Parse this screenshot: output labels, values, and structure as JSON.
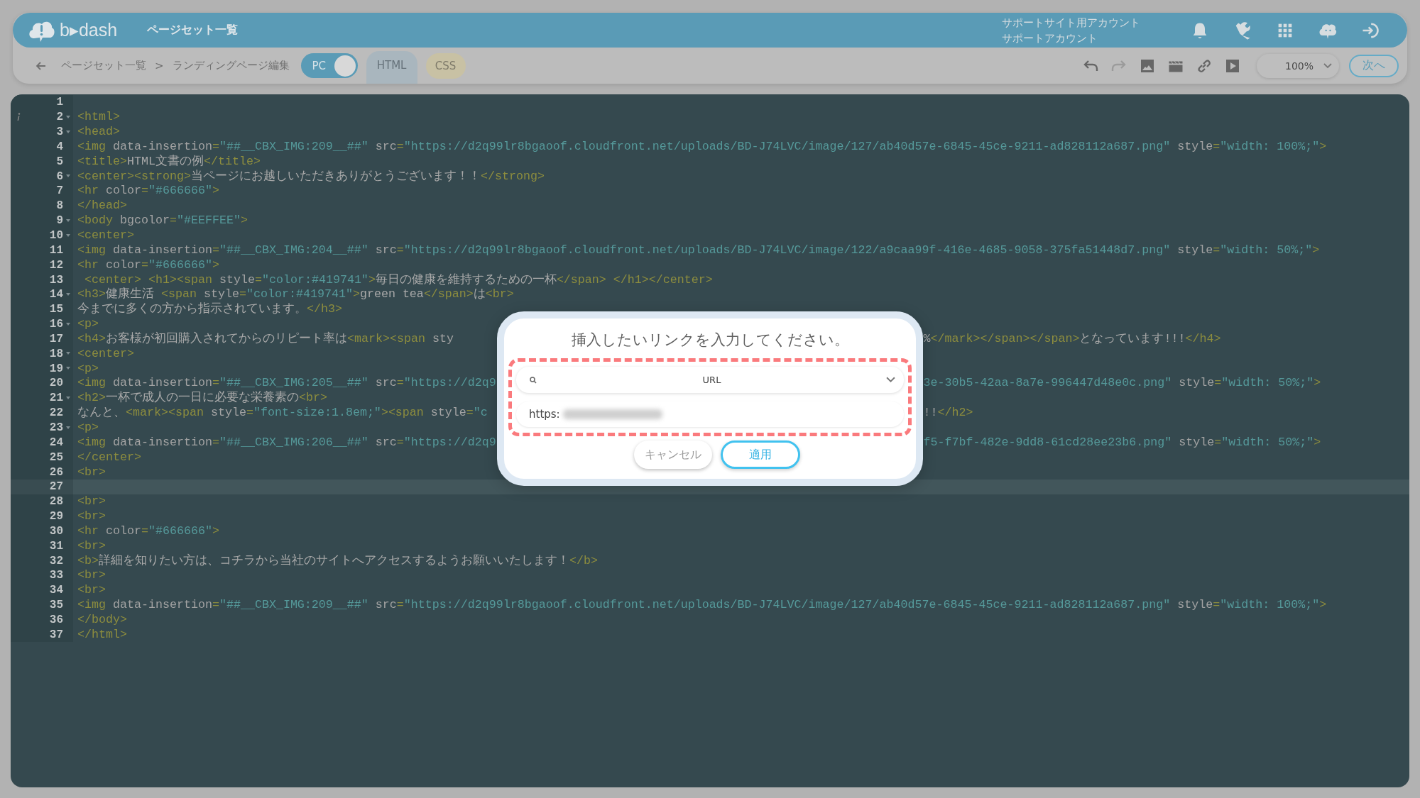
{
  "header": {
    "logo": "b▸dash",
    "title": "ページセット一覧",
    "account_lines": [
      "サポートサイト用アカウント",
      "サポートアカウント"
    ],
    "icons": [
      {
        "kind": "bell"
      },
      {
        "kind": "wrench"
      },
      {
        "kind": "grid"
      },
      {
        "kind": "cloud"
      },
      {
        "kind": "signin"
      }
    ]
  },
  "toolbar": {
    "breadcrumb": {
      "parent": "ページセット一覧",
      "separator": ">",
      "current": "ランディングページ編集"
    },
    "device_toggle": {
      "label": "PC",
      "on": true
    },
    "tabs": [
      {
        "label": "HTML",
        "selected": true
      },
      {
        "label": "CSS",
        "selected": false
      }
    ],
    "tools": [
      {
        "kind": "undo",
        "disabled": false
      },
      {
        "kind": "redo",
        "disabled": true
      },
      {
        "kind": "image",
        "disabled": false
      },
      {
        "kind": "film",
        "disabled": false
      },
      {
        "kind": "link",
        "disabled": false
      },
      {
        "kind": "play",
        "disabled": false
      }
    ],
    "zoom": {
      "value": "100%"
    },
    "next_button": "次へ"
  },
  "editor": {
    "lines": [
      {
        "n": "1",
        "fold": false,
        "info": false,
        "current": false
      },
      {
        "n": "2",
        "code": "<html>",
        "fold": true,
        "info": true,
        "current": false
      },
      {
        "n": "3",
        "code": "<head>",
        "fold": true,
        "info": false,
        "current": false
      },
      {
        "n": "4",
        "code": "<img data-insertion=\"##__CBX_IMG:209__##\" src=\"https://d2q99lr8bgaoof.cloudfront.net/uploads/BD-J74LVC/image/127/ab40d57e-6845-45ce-9211-ad828112a687.png\" style=\"width: 100%;\">",
        "fold": false,
        "info": false,
        "current": false
      },
      {
        "n": "5",
        "code": "<title>HTML文書の例</title>",
        "fold": false,
        "info": false,
        "current": false
      },
      {
        "n": "6",
        "code": "<center><strong>当ページにお越しいただきありがとうございます！！</strong>",
        "fold": true,
        "info": false,
        "current": false
      },
      {
        "n": "7",
        "code": "<hr color=\"#666666\">",
        "fold": false,
        "info": false,
        "current": false
      },
      {
        "n": "8",
        "code": "</head>",
        "fold": false,
        "info": false,
        "current": false
      },
      {
        "n": "9",
        "code": "<body bgcolor=\"#EEFFEE\">",
        "fold": true,
        "info": false,
        "current": false
      },
      {
        "n": "10",
        "code": "<center>",
        "fold": true,
        "info": false,
        "current": false
      },
      {
        "n": "11",
        "code": "<img data-insertion=\"##__CBX_IMG:204__##\" src=\"https://d2q99lr8bgaoof.cloudfront.net/uploads/BD-J74LVC/image/122/a9caa99f-416e-4685-9058-375fa51448d7.png\" style=\"width: 50%;\">",
        "fold": false,
        "info": false,
        "current": false
      },
      {
        "n": "12",
        "code": "<hr color=\"#666666\">",
        "fold": false,
        "info": false,
        "current": false
      },
      {
        "n": "13",
        "code": " <center> <h1><span style=\"color:#419741\">毎日の健康を維持するための一杯</span> </h1></center>",
        "fold": false,
        "info": false,
        "current": false
      },
      {
        "n": "14",
        "code": "<h3>健康生活 <span style=\"color:#419741\">green tea</span>は<br>",
        "fold": true,
        "info": false,
        "current": false
      },
      {
        "n": "15",
        "code": "今までに多くの方から指示されています。</h3>",
        "fold": false,
        "info": false,
        "current": false
      },
      {
        "n": "16",
        "code": "<p>",
        "fold": true,
        "info": false,
        "current": false
      },
      {
        "n": "17",
        "code": "<h4>お客様が初回購入されてからのリピート率は<mark><span sty",
        "tail": {
          "kind": "text",
          "text": "%</mark></span></span>となっています!!!</h4>"
        },
        "fold": false,
        "info": false,
        "current": false
      },
      {
        "n": "18",
        "code": "<center>",
        "fold": true,
        "info": false,
        "current": false
      },
      {
        "n": "19",
        "code": "<p>",
        "fold": true,
        "info": false,
        "current": false
      },
      {
        "n": "20",
        "code": "<img data-insertion=\"##__CBX_IMG:205__##\" src=\"https://d2q9",
        "tail": {
          "kind": "value",
          "text": "3e-30b5-42aa-8a7e-996447d48e0c.png\" style=\"width: 50%;\">"
        },
        "fold": false,
        "info": false,
        "current": false
      },
      {
        "n": "21",
        "code": "<h2>一杯で成人の一日に必要な栄養素の<br>",
        "fold": true,
        "info": false,
        "current": false
      },
      {
        "n": "22",
        "code": "なんと、<mark><span style=\"font-size:1.8em;\"><span style=\"c",
        "tail": {
          "kind": "text",
          "text": "!!</h2>"
        },
        "fold": false,
        "info": false,
        "current": false
      },
      {
        "n": "23",
        "code": "<p>",
        "fold": true,
        "info": false,
        "current": false
      },
      {
        "n": "24",
        "code": "<img data-insertion=\"##__CBX_IMG:206__##\" src=\"https://d2q9",
        "tail": {
          "kind": "value",
          "text": "f5-f7bf-482e-9dd8-61cd28ee23b6.png\" style=\"width: 50%;\">"
        },
        "fold": false,
        "info": false,
        "current": false
      },
      {
        "n": "25",
        "code": "</center>",
        "fold": false,
        "info": false,
        "current": false
      },
      {
        "n": "26",
        "code": "<br>",
        "fold": false,
        "info": false,
        "current": false
      },
      {
        "n": "27",
        "fold": false,
        "info": false,
        "current": true
      },
      {
        "n": "28",
        "code": "<br>",
        "fold": false,
        "info": false,
        "current": false
      },
      {
        "n": "29",
        "code": "<br>",
        "fold": false,
        "info": false,
        "current": false
      },
      {
        "n": "30",
        "code": "<hr color=\"#666666\">",
        "fold": false,
        "info": false,
        "current": false
      },
      {
        "n": "31",
        "code": "<br>",
        "fold": false,
        "info": false,
        "current": false
      },
      {
        "n": "32",
        "code": "<b>詳細を知りたい方は、コチラから当社のサイトへアクセスするようお願いいたします！</b>",
        "fold": false,
        "info": false,
        "current": false
      },
      {
        "n": "33",
        "code": "<br>",
        "fold": false,
        "info": false,
        "current": false
      },
      {
        "n": "34",
        "code": "<br>",
        "fold": false,
        "info": false,
        "current": false
      },
      {
        "n": "35",
        "code": "<img data-insertion=\"##__CBX_IMG:209__##\" src=\"https://d2q99lr8bgaoof.cloudfront.net/uploads/BD-J74LVC/image/127/ab40d57e-6845-45ce-9211-ad828112a687.png\" style=\"width: 100%;\">",
        "fold": false,
        "info": false,
        "current": false
      },
      {
        "n": "36",
        "code": "</body>",
        "fold": false,
        "info": false,
        "current": false
      },
      {
        "n": "37",
        "code": "</html>",
        "fold": false,
        "info": false,
        "current": false
      }
    ]
  },
  "dialog": {
    "title": "挿入したいリンクを入力してください。",
    "link_type": {
      "value": "URL"
    },
    "url_field": {
      "value": "https:"
    },
    "buttons": [
      {
        "label": "キャンセル",
        "kind": "secondary"
      },
      {
        "label": "適用",
        "kind": "primary"
      }
    ]
  }
}
